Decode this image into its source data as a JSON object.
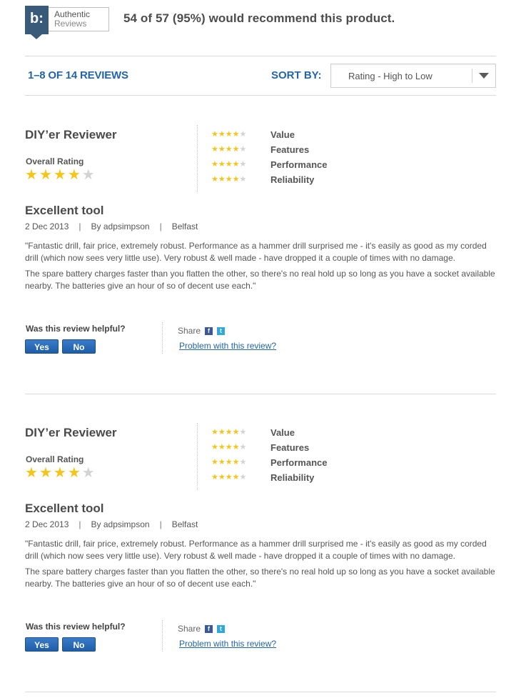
{
  "badge": {
    "mark": "b:",
    "line1": "Authentic",
    "line2": "Reviews"
  },
  "recommend_text": "54 of 57 (95%) would recommend this product.",
  "reviews_count": "1–8 OF 14 REVIEWS",
  "sort": {
    "label": "SORT BY:",
    "selected": "Rating - High to Low"
  },
  "colors": {
    "accent": "#2266a8",
    "star": "#f5c518",
    "button": "#1f5ea8"
  },
  "icons": [
    "facebook-icon",
    "twitter-icon",
    "star-icon",
    "chevron-down-icon"
  ],
  "reviews": [
    {
      "reviewer": "DIY’er Reviewer",
      "overall_label": "Overall Rating",
      "overall_rating": 4,
      "attributes": [
        {
          "label": "Value",
          "rating": 4
        },
        {
          "label": "Features",
          "rating": 4
        },
        {
          "label": "Performance",
          "rating": 4
        },
        {
          "label": "Reliability",
          "rating": 4
        }
      ],
      "title": "Excellent tool",
      "date": "2 Dec 2013",
      "sep1": "|",
      "author": "By adpsimpson",
      "sep2": "|",
      "location": "Belfast",
      "paragraph1": "\"Fantastic drill, fair price, extremely robust. Performance as a hammer drill surprised me - it's easily as good as my corded drill (which now sees very little use). Very robust & well made - have dropped it a couple of times with no damage.",
      "paragraph2": "The spare battery charges faster than you flatten the other, so there's no real hold up so long as you have a socket available nearby. The batteries give an hour of so of decent use each.\"",
      "helpful_label": "Was this review helpful?",
      "yes_label": "Yes",
      "no_label": "No",
      "share_label": "Share",
      "fb_glyph": "f",
      "tw_glyph": "t",
      "problem_label": "Problem with this review?"
    },
    {
      "reviewer": "DIY’er Reviewer",
      "overall_label": "Overall Rating",
      "overall_rating": 4,
      "attributes": [
        {
          "label": "Value",
          "rating": 4
        },
        {
          "label": "Features",
          "rating": 4
        },
        {
          "label": "Performance",
          "rating": 4
        },
        {
          "label": "Reliability",
          "rating": 4
        }
      ],
      "title": "Excellent tool",
      "date": "2 Dec 2013",
      "sep1": "|",
      "author": "By adpsimpson",
      "sep2": "|",
      "location": "Belfast",
      "paragraph1": "\"Fantastic drill, fair price, extremely robust. Performance as a hammer drill surprised me - it's easily as good as my corded drill (which now sees very little use). Very robust & well made - have dropped it a couple of times with no damage.",
      "paragraph2": "The spare battery charges faster than you flatten the other, so there's no real hold up so long as you have a socket available nearby. The batteries give an hour of so of decent use each.\"",
      "helpful_label": "Was this review helpful?",
      "yes_label": "Yes",
      "no_label": "No",
      "share_label": "Share",
      "fb_glyph": "f",
      "tw_glyph": "t",
      "problem_label": "Problem with this review?"
    }
  ]
}
